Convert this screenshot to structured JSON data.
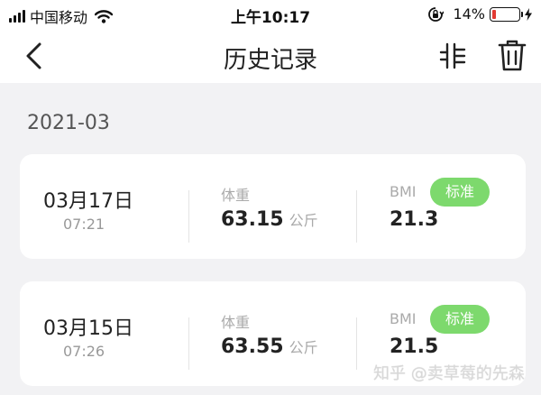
{
  "status_bar": {
    "carrier": "中国移动",
    "time": "上午10:17",
    "battery_percent": "14%",
    "battery_level": 0.14,
    "battery_color": "#e23a33"
  },
  "navbar": {
    "title": "历史记录",
    "back_icon": "chevron-left-icon",
    "filter_icon": "filter-icon",
    "delete_icon": "trash-icon"
  },
  "section": {
    "month": "2021-03"
  },
  "records": [
    {
      "date": "03月17日",
      "time": "07:21",
      "weight_label": "体重",
      "weight": "63.15",
      "weight_unit": "公斤",
      "bmi_label": "BMI",
      "bmi": "21.3",
      "status": "标准"
    },
    {
      "date": "03月15日",
      "time": "07:26",
      "weight_label": "体重",
      "weight": "63.55",
      "weight_unit": "公斤",
      "bmi_label": "BMI",
      "bmi": "21.5",
      "status": "标准"
    }
  ],
  "watermark": "知乎 @卖草莓的先森",
  "colors": {
    "badge": "#7dd96d",
    "background": "#f2f2f4"
  }
}
